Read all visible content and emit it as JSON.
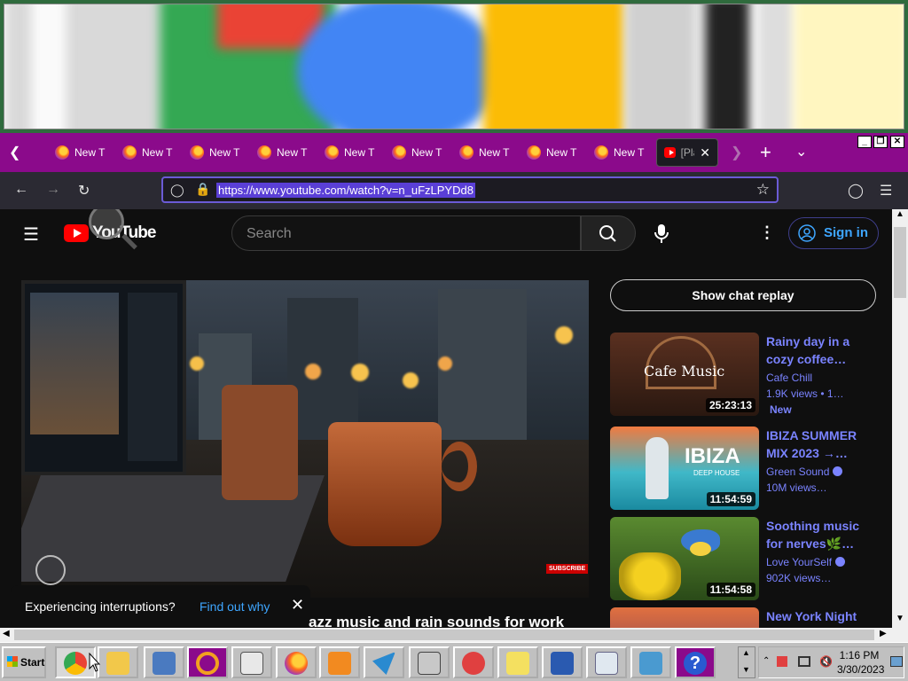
{
  "browser": {
    "tabs": [
      {
        "label": "New T"
      },
      {
        "label": "New T"
      },
      {
        "label": "New T"
      },
      {
        "label": "New T"
      },
      {
        "label": "New T"
      },
      {
        "label": "New T"
      },
      {
        "label": "New T"
      },
      {
        "label": "New T"
      },
      {
        "label": "New T"
      }
    ],
    "active_tab": {
      "label": "[Pla"
    },
    "url": "https://www.youtube.com/watch?v=n_uFzLPYDd8"
  },
  "youtube": {
    "logo_text": "YouTube",
    "search_placeholder": "Search",
    "signin_label": "Sign in",
    "chat_replay_label": "Show chat replay",
    "toast_text": "Experiencing interruptions?",
    "toast_link": "Find out why",
    "video_title": "azz music and rain sounds for work",
    "subscribe_overlay": "SUBSCRIBE",
    "recommendations": [
      {
        "title": "Rainy day in a cozy coffee…",
        "channel": "Cafe Chill",
        "views": "1.9K views  •  1…",
        "badge": "New",
        "duration": "25:23:13",
        "thumb_text": "Cafe Music"
      },
      {
        "title": "IBIZA SUMMER MIX 2023 →…",
        "channel": "Green Sound",
        "views": "10M views…",
        "duration": "11:54:59",
        "thumb_text": "IBIZA",
        "thumb_sub": "DEEP HOUSE"
      },
      {
        "title": "Soothing music for nerves🌿…",
        "channel": "Love YourSelf",
        "views": "902K views…",
        "duration": "11:54:58"
      },
      {
        "title": "New York Night"
      }
    ]
  },
  "taskbar": {
    "start_label": "Start",
    "time": "1:16 PM",
    "date": "3/30/2023"
  }
}
